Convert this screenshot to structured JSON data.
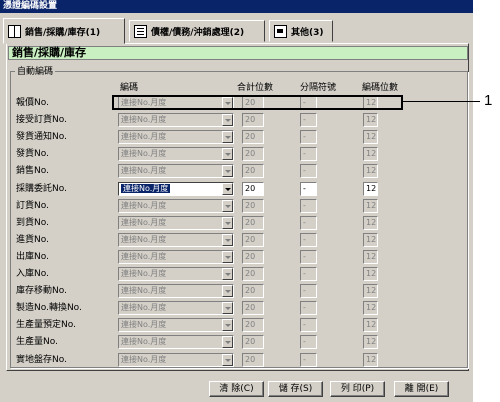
{
  "window": {
    "title": "憑證編碼設置"
  },
  "tabs": [
    {
      "label": "銷售/採購/庫存(1)",
      "icon": "book-icon",
      "active": true
    },
    {
      "label": "債權/債務/沖銷處理(2)",
      "icon": "ledger-icon",
      "active": false
    },
    {
      "label": "其他(3)",
      "icon": "misc-icon",
      "active": false
    }
  ],
  "section": {
    "title": "銷售/採購/庫存"
  },
  "group": {
    "title": "自動編碼",
    "headers": {
      "code": "編碼",
      "total": "合計位數",
      "sep": "分隔符號",
      "digits": "編碼位數"
    }
  },
  "rows": [
    {
      "label": "報價No.",
      "code": "連接No.月度",
      "total": "20",
      "sep": "-",
      "digits": "12",
      "active": false
    },
    {
      "label": "接受訂貨No.",
      "code": "連接No.月度",
      "total": "20",
      "sep": "-",
      "digits": "12",
      "active": false
    },
    {
      "label": "發貨通知No.",
      "code": "連接No.月度",
      "total": "20",
      "sep": "-",
      "digits": "12",
      "active": false
    },
    {
      "label": "發貨No.",
      "code": "連接No.月度",
      "total": "20",
      "sep": "-",
      "digits": "12",
      "active": false
    },
    {
      "label": "銷售No.",
      "code": "連接No.月度",
      "total": "20",
      "sep": "-",
      "digits": "12",
      "active": false
    },
    {
      "label": "採購委託No.",
      "code": "連接No.月度",
      "total": "20",
      "sep": "-",
      "digits": "12",
      "active": true
    },
    {
      "label": "訂貨No.",
      "code": "連接No.月度",
      "total": "20",
      "sep": "-",
      "digits": "12",
      "active": false
    },
    {
      "label": "到貨No.",
      "code": "連接No.月度",
      "total": "20",
      "sep": "-",
      "digits": "12",
      "active": false
    },
    {
      "label": "進貨No.",
      "code": "連接No.月度",
      "total": "20",
      "sep": "-",
      "digits": "12",
      "active": false
    },
    {
      "label": "出庫No.",
      "code": "連接No.月度",
      "total": "20",
      "sep": "-",
      "digits": "12",
      "active": false
    },
    {
      "label": "入庫No.",
      "code": "連接No.月度",
      "total": "20",
      "sep": "-",
      "digits": "12",
      "active": false
    },
    {
      "label": "庫存移動No.",
      "code": "連接No.月度",
      "total": "20",
      "sep": "-",
      "digits": "12",
      "active": false
    },
    {
      "label": "製造No.轉換No.",
      "code": "連接No.月度",
      "total": "20",
      "sep": "-",
      "digits": "12",
      "active": false
    },
    {
      "label": "生產量預定No.",
      "code": "連接No.月度",
      "total": "20",
      "sep": "-",
      "digits": "12",
      "active": false
    },
    {
      "label": "生產量No.",
      "code": "連接No.月度",
      "total": "20",
      "sep": "-",
      "digits": "12",
      "active": false
    },
    {
      "label": "實地盤存No.",
      "code": "連接No.月度",
      "total": "20",
      "sep": "-",
      "digits": "12",
      "active": false
    }
  ],
  "callout": {
    "number": "1"
  },
  "buttons": {
    "clear": "清 除(C)",
    "save": "儲 存(S)",
    "print": "列 印(P)",
    "close": "離 開(E)"
  },
  "colors": {
    "section_banner": "#c8f0c0",
    "titlebar": "#0a246a",
    "face": "#d4d0c8"
  }
}
